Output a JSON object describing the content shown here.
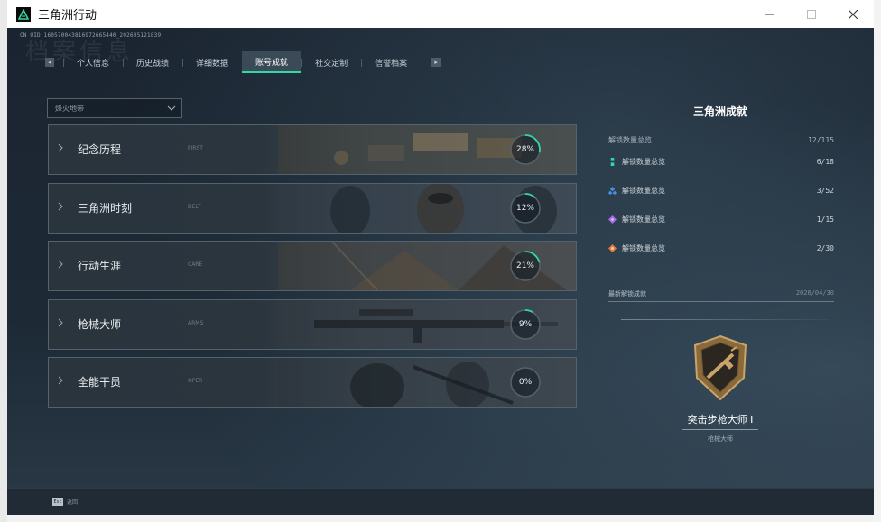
{
  "window": {
    "title": "三角洲行动"
  },
  "header": {
    "uid": "CN UID:1605700438169726654​40_202605121839",
    "watermark": "档案信息"
  },
  "tabs": [
    {
      "label": "个人信息",
      "active": false
    },
    {
      "label": "历史战绩",
      "active": false
    },
    {
      "label": "详细数据",
      "active": false
    },
    {
      "label": "账号成就",
      "active": true
    },
    {
      "label": "社交定制",
      "active": false
    },
    {
      "label": "信誉档案",
      "active": false
    }
  ],
  "filter": {
    "value": "烽火地带"
  },
  "categories": [
    {
      "name": "纪念历程",
      "en": "FIRST",
      "percent": 28,
      "percent_label": "28%"
    },
    {
      "name": "三角洲时刻",
      "en": "DELT",
      "percent": 12,
      "percent_label": "12%"
    },
    {
      "name": "行动生涯",
      "en": "CARE",
      "percent": 21,
      "percent_label": "21%"
    },
    {
      "name": "枪械大师",
      "en": "ARMS",
      "percent": 9,
      "percent_label": "9%"
    },
    {
      "name": "全能干员",
      "en": "OPER",
      "percent": 0,
      "percent_label": "0%"
    }
  ],
  "panel": {
    "title": "三角洲成就",
    "summary_label": "解锁数量总览",
    "summary_value": "12/115",
    "lines": [
      {
        "label": "解锁数量总览",
        "value": "6/18",
        "color": "#2fd8a5"
      },
      {
        "label": "解锁数量总览",
        "value": "3/52",
        "color": "#4a8fe0"
      },
      {
        "label": "解锁数量总览",
        "value": "1/15",
        "color": "#a86be8"
      },
      {
        "label": "解锁数量总览",
        "value": "2/30",
        "color": "#e07a3a"
      }
    ],
    "recent_label": "最新解锁成就",
    "recent_date": "2026/04/30",
    "badge_name": "突击步枪大师 I",
    "badge_category": "枪械大师"
  },
  "footer": {
    "esc_key": "Esc",
    "esc_label": "返回"
  },
  "colors": {
    "accent": "#2fd8a5",
    "background": "#1b2733"
  }
}
